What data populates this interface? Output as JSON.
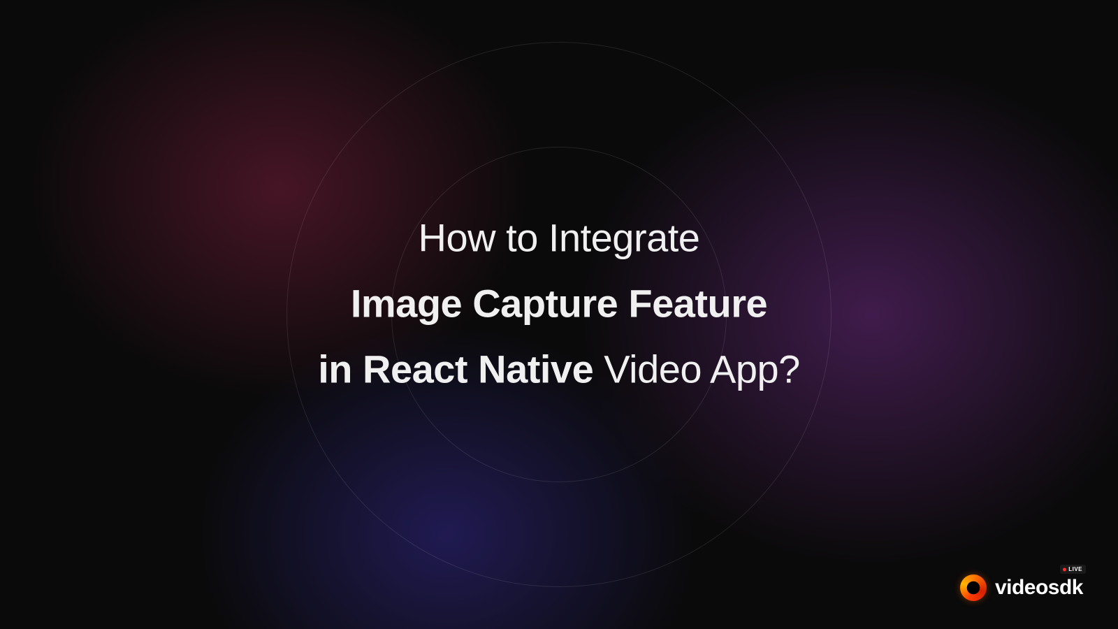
{
  "headline": {
    "line1_light": "How to Integrate",
    "line2_bold": "Image Capture Feature",
    "line3_bold": "in React Native",
    "line3_light": " Video App?"
  },
  "brand": {
    "name": "videosdk",
    "badge": "LIVE"
  }
}
